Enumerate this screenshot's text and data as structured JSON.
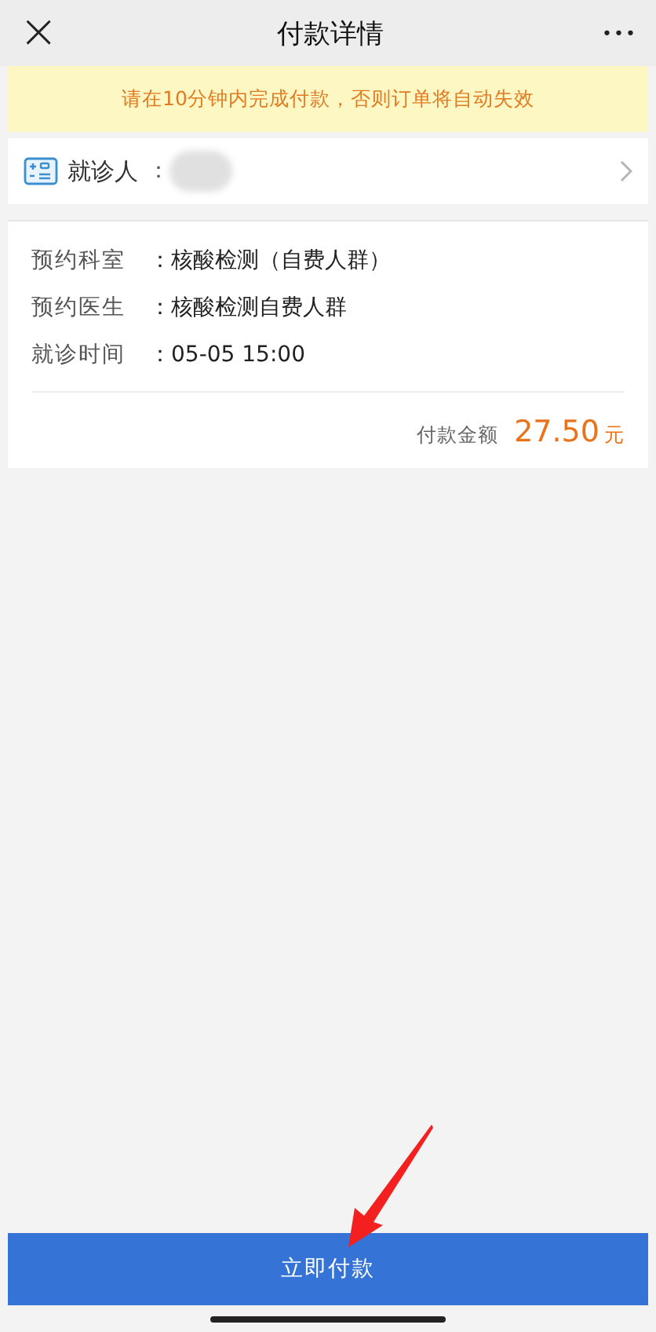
{
  "nav": {
    "close": "×",
    "title": "付款详情",
    "more": "•••"
  },
  "notice": "请在10分钟内完成付款，否则订单将自动失效",
  "patient": {
    "label": "就诊人",
    "colon": "："
  },
  "details": [
    {
      "label": "预约科室",
      "value": "：核酸检测（自费人群）"
    },
    {
      "label": "预约医生",
      "value": "：核酸检测自费人群"
    },
    {
      "label": "就诊时间",
      "value": "：05-05 15:00"
    }
  ],
  "amount": {
    "label": "付款金额",
    "value": "27.50",
    "unit": "元"
  },
  "pay_button": "立即付款"
}
